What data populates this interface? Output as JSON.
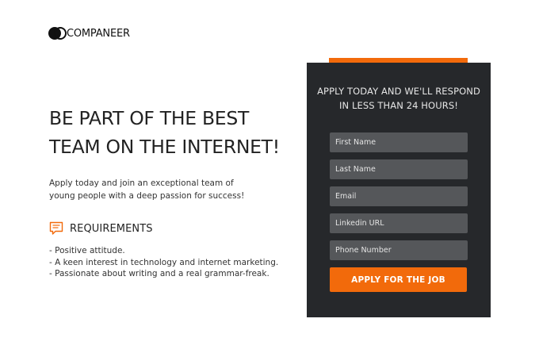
{
  "brand": {
    "name": "COMPANEER"
  },
  "hero": {
    "headline": "BE PART OF THE BEST TEAM ON THE INTERNET!",
    "intro": "Apply today and join an exceptional team of young people with a deep passion for success!"
  },
  "requirements": {
    "title": "REQUIREMENTS",
    "icon": "chat-bubble-icon",
    "items": [
      "- Positive attitude.",
      "- A keen interest in technology and internet marketing.",
      "- Passionate about writing and a real grammar-freak."
    ]
  },
  "form": {
    "heading_line1": "APPLY TODAY AND WE'LL RESPOND",
    "heading_line2": "IN LESS THAN 24 HOURS!",
    "fields": {
      "first_name": {
        "placeholder": "First Name",
        "value": ""
      },
      "last_name": {
        "placeholder": "Last Name",
        "value": ""
      },
      "email": {
        "placeholder": "Email",
        "value": ""
      },
      "linkedin": {
        "placeholder": "Linkedin URL",
        "value": ""
      },
      "phone": {
        "placeholder": "Phone Number",
        "value": ""
      }
    },
    "submit_label": "APPLY FOR THE JOB"
  },
  "colors": {
    "accent": "#f26a0b",
    "panel": "#26282b",
    "field": "#55575a",
    "text": "#222222"
  }
}
